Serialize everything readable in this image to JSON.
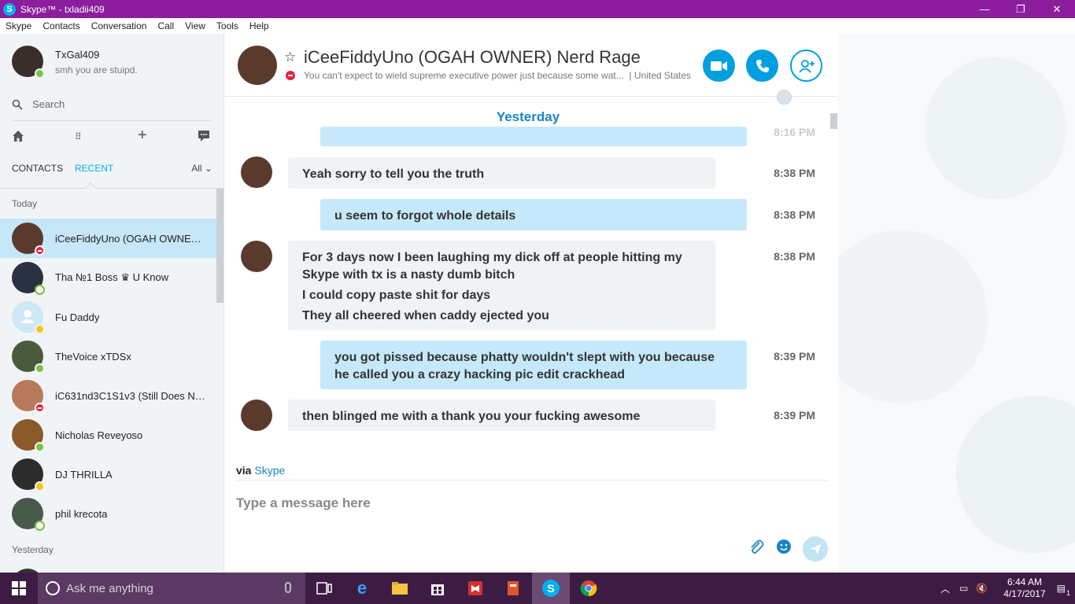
{
  "window": {
    "title": "Skype™ - txladii409",
    "controls": [
      "—",
      "❐",
      "✕"
    ]
  },
  "menu": [
    "Skype",
    "Contacts",
    "Conversation",
    "Call",
    "View",
    "Tools",
    "Help"
  ],
  "profile": {
    "name": "TxGal409",
    "mood": "smh you are stuipd."
  },
  "search": {
    "placeholder": "Search"
  },
  "tabs": {
    "contacts": "CONTACTS",
    "recent": "RECENT",
    "all": "All"
  },
  "sections": {
    "today": "Today",
    "yesterday": "Yesterday"
  },
  "contacts": [
    {
      "name": "iCeeFiddyUno (OGAH OWNER)...",
      "status": "dnd",
      "color": "#5b3a2e"
    },
    {
      "name": "Tha №1 Boss ♛ U Know",
      "status": "off",
      "color": "#2a3140"
    },
    {
      "name": "Fu Daddy",
      "status": "away",
      "color": "#cfe8f6"
    },
    {
      "name": "TheVoice xTDSx",
      "status": "on",
      "color": "#4a5a3c"
    },
    {
      "name": "iC631nd3C1S1v3 (Still Does No...",
      "status": "dnd",
      "color": "#b87a5a"
    },
    {
      "name": "Nicholas Reveyoso",
      "status": "on",
      "color": "#8a5a2a"
    },
    {
      "name": "DJ THRILLA",
      "status": "away",
      "color": "#2c2c2c"
    },
    {
      "name": "phil krecota",
      "status": "off",
      "color": "#4a5a4a"
    }
  ],
  "conversation": {
    "title": "iCeeFiddyUno (OGAH OWNER) Nerd Rage",
    "mood": "You can't expect to wield supreme executive power just because some wat...",
    "location": "| United States",
    "day": "Yesterday",
    "partial_time": "8:16 PM",
    "messages": [
      {
        "dir": "in",
        "lines": [
          "Yeah sorry to tell you the truth"
        ],
        "time": "8:38 PM"
      },
      {
        "dir": "out",
        "lines": [
          "u seem to forgot  whole details"
        ],
        "time": "8:38 PM"
      },
      {
        "dir": "in",
        "lines": [
          "For 3 days now I been laughing my dick off at people hitting my Skype with tx is a nasty dumb bitch",
          "I could copy paste shit for days",
          "They all cheered when caddy ejected you"
        ],
        "time": "8:38 PM"
      },
      {
        "dir": "out",
        "lines": [
          "you got pissed  because phatty wouldn't slept with you because he called you  a crazy hacking pic edit crackhead"
        ],
        "time": "8:39 PM"
      },
      {
        "dir": "in",
        "lines": [
          "then blinged me with a thank you your fucking awesome"
        ],
        "time": "8:39 PM"
      }
    ],
    "via_label": "via",
    "via_link": "Skype",
    "composer_placeholder": "Type a message here"
  },
  "taskbar": {
    "search_placeholder": "Ask me anything",
    "time": "6:44 AM",
    "date": "4/17/2017",
    "notification_count": "1"
  },
  "colors": {
    "titlebar": "#8c1e9e",
    "accent": "#00aff0",
    "taskbar": "#3d1c44"
  }
}
